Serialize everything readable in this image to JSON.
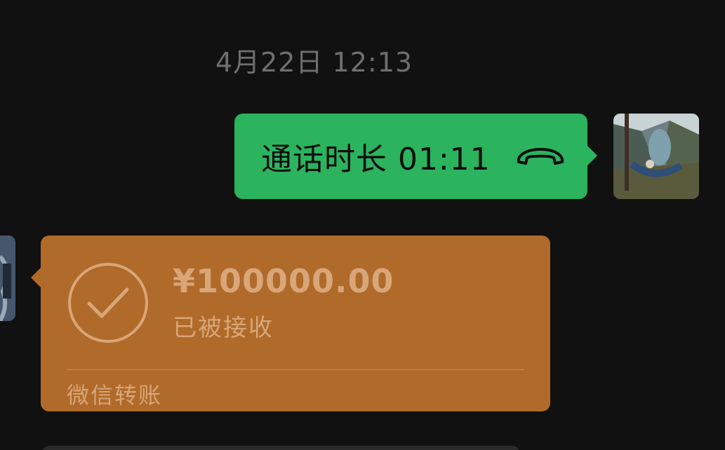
{
  "conversation": {
    "timestamp": "4月22日 12:13"
  },
  "call_message": {
    "text": "通话时长 01:11",
    "icon": "phone-hangup-icon",
    "bubble_color": "#2bb35e"
  },
  "transfer_message": {
    "amount": "¥100000.00",
    "status": "已被接收",
    "footer": "微信转账",
    "icon": "check-circle-icon",
    "card_color": "#b06a2a"
  }
}
